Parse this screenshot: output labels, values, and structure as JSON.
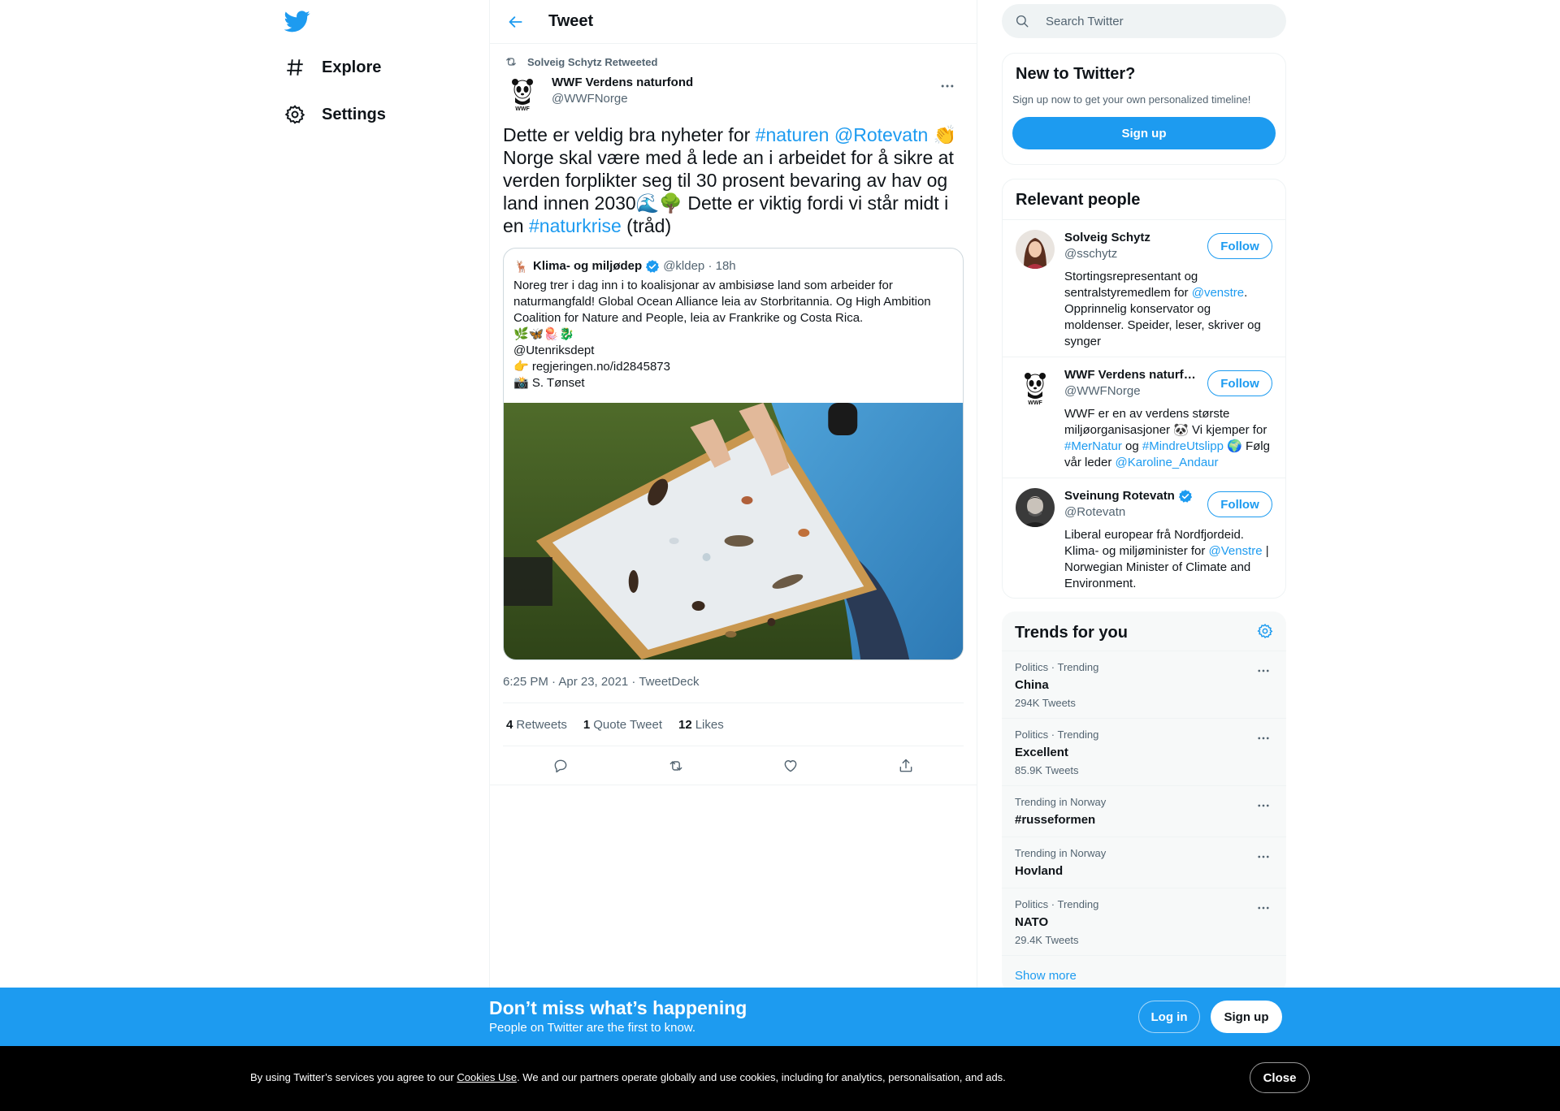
{
  "nav": {
    "items": [
      {
        "label": "Explore",
        "icon": "hashtag-icon"
      },
      {
        "label": "Settings",
        "icon": "gear-icon"
      }
    ]
  },
  "main": {
    "title": "Tweet"
  },
  "tweet": {
    "retweeted_by": "Solveig Schytz Retweeted",
    "author_name": "WWF Verdens naturfond",
    "author_handle": "@WWFNorge",
    "text_parts": [
      "Dette er veldig bra nyheter for ",
      "#naturen",
      " ",
      "@Rotevatn",
      " 👏 Norge skal være med å lede an i arbeidet for å sikre at verden forplikter seg til 30 prosent bevaring av hav og land innen 2030🌊🌳 Dette er viktig fordi vi står midt i en ",
      "#naturkrise",
      " (tråd)"
    ],
    "quote": {
      "avatar_glyph": "🦌",
      "name": "Klima- og miljødep",
      "handle": "@kldep",
      "time": "18h",
      "text": "Noreg trer i dag inn i to koalisjonar av ambisiøse land som arbeider for naturmangfald! Global Ocean Alliance leia av Storbritannia. Og High Ambition Coalition for Nature and People, leia av Frankrike og Costa Rica.\n🌿🦋🪼🐉\n@Utenriksdept\n👉 regjeringen.no/id2845873\n📸 S. Tønset"
    },
    "meta": "6:25 PM · Apr 23, 2021 · TweetDeck",
    "stats": {
      "retweets_count": "4",
      "retweets_label": "Retweets",
      "quotes_count": "1",
      "quotes_label": "Quote Tweet",
      "likes_count": "12",
      "likes_label": "Likes"
    }
  },
  "search": {
    "placeholder": "Search Twitter"
  },
  "new_to_twitter": {
    "title": "New to Twitter?",
    "subtitle": "Sign up now to get your own personalized timeline!",
    "button": "Sign up"
  },
  "relevant": {
    "title": "Relevant people",
    "follow_label": "Follow",
    "people": [
      {
        "name": "Solveig Schytz",
        "handle": "@sschytz",
        "bio_parts": [
          "Stortingsrepresentant og sentralstyremedlem for ",
          "@venstre",
          ". Opprinnelig konservator og moldenser. Speider, leser, skriver og synger"
        ]
      },
      {
        "name": "WWF Verdens naturfond",
        "handle": "@WWFNorge",
        "bio_parts": [
          "WWF er en av verdens største miljøorganisasjoner 🐼 Vi kjemper for ",
          "#MerNatur",
          " og ",
          "#MindreUtslipp",
          " 🌍 Følg vår leder ",
          "@Karoline_Andaur"
        ]
      },
      {
        "name": "Sveinung Rotevatn",
        "handle": "@Rotevatn",
        "bio_parts": [
          "Liberal europear frå Nordfjordeid. Klima- og miljøminister for ",
          "@Venstre",
          " | Norwegian Minister of Climate and Environment."
        ]
      }
    ]
  },
  "trends": {
    "title": "Trends for you",
    "items": [
      {
        "context": "Politics · Trending",
        "name": "China",
        "count": "294K Tweets"
      },
      {
        "context": "Politics · Trending",
        "name": "Excellent",
        "count": "85.9K Tweets"
      },
      {
        "context": "Trending in Norway",
        "name": "#russeformen",
        "count": ""
      },
      {
        "context": "Trending in Norway",
        "name": "Hovland",
        "count": ""
      },
      {
        "context": "Politics · Trending",
        "name": "NATO",
        "count": "29.4K Tweets"
      }
    ],
    "show_more": "Show more"
  },
  "bottom_bar": {
    "title": "Don’t miss what’s happening",
    "subtitle": "People on Twitter are the first to know.",
    "login": "Log in",
    "signup": "Sign up"
  },
  "cookie": {
    "text_before": "By using Twitter’s services you agree to our ",
    "link": "Cookies Use",
    "text_after": ". We and our partners operate globally and use cookies, including for analytics, personalisation, and ads.",
    "close": "Close"
  },
  "colors": {
    "accent": "#1d9bf0",
    "text": "#0f1419",
    "muted": "#536471"
  }
}
